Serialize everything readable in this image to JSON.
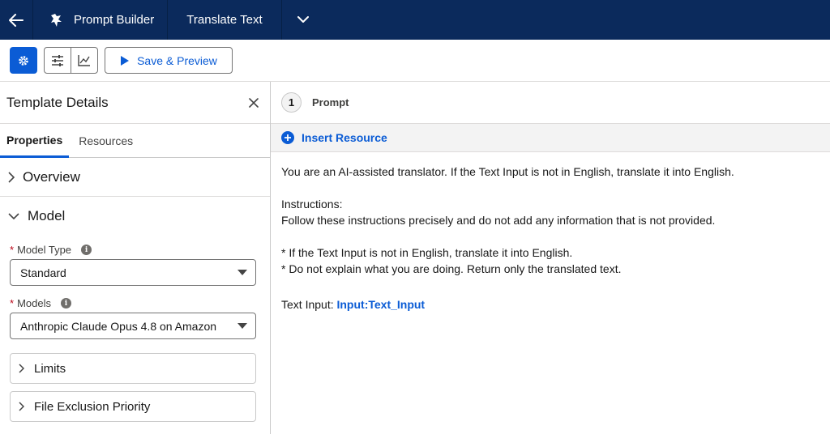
{
  "topbar": {
    "app_name": "Prompt Builder",
    "tab_label": "Translate Text"
  },
  "toolbar": {
    "save_preview_label": "Save & Preview"
  },
  "left_panel": {
    "title": "Template Details",
    "tabs": [
      {
        "label": "Properties",
        "active": true
      },
      {
        "label": "Resources",
        "active": false
      }
    ],
    "sections": {
      "overview": "Overview",
      "model": "Model"
    },
    "model_type": {
      "label": "Model Type",
      "value": "Standard"
    },
    "models": {
      "label": "Models",
      "value": "Anthropic Claude Opus 4.8 on Amazon"
    },
    "limits_label": "Limits",
    "file_exclusion_label": "File Exclusion Priority"
  },
  "right_panel": {
    "step_number": "1",
    "title": "Prompt",
    "insert_resource_label": "Insert Resource",
    "prompt": {
      "line1": "You are an AI-assisted translator. If the Text Input is not in English, translate it into English.",
      "line2": "Instructions:",
      "line3": "Follow these instructions precisely and do not add any information that is not provided.",
      "line4": "* If the Text Input is not in English, translate it into English.",
      "line5": "* Do not explain what you are doing. Return only the translated text.",
      "input_label": "Text Input:",
      "merge_field": "Input:Text_Input"
    }
  },
  "colors": {
    "nav_bg": "#0b2a5c",
    "accent": "#0b5cd5"
  }
}
